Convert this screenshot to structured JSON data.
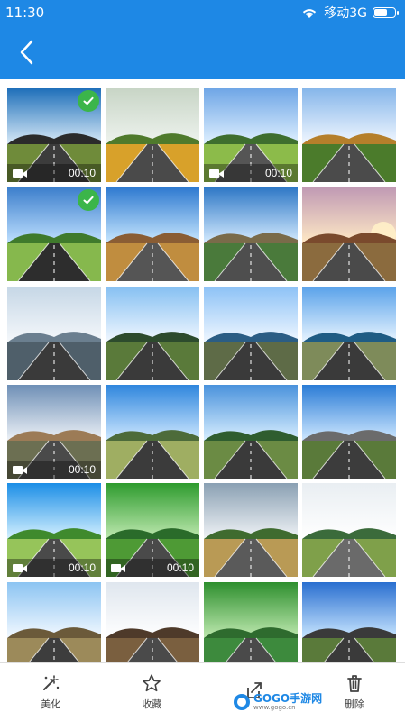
{
  "status": {
    "time": "11:30",
    "carrier": "移动3G"
  },
  "app": {
    "back_icon": "chevron-left-icon",
    "accent_color": "#1e88e5"
  },
  "grid": {
    "items": [
      {
        "duration": "00:10",
        "selected": true,
        "is_video": true
      },
      {
        "duration": "",
        "selected": false,
        "is_video": false
      },
      {
        "duration": "00:10",
        "selected": false,
        "is_video": true
      },
      {
        "duration": "",
        "selected": false,
        "is_video": false
      },
      {
        "duration": "",
        "selected": true,
        "is_video": false
      },
      {
        "duration": "",
        "selected": false,
        "is_video": false
      },
      {
        "duration": "",
        "selected": false,
        "is_video": false
      },
      {
        "duration": "",
        "selected": false,
        "is_video": false
      },
      {
        "duration": "",
        "selected": false,
        "is_video": false
      },
      {
        "duration": "",
        "selected": false,
        "is_video": false
      },
      {
        "duration": "",
        "selected": false,
        "is_video": false
      },
      {
        "duration": "",
        "selected": false,
        "is_video": false
      },
      {
        "duration": "00:10",
        "selected": false,
        "is_video": true
      },
      {
        "duration": "",
        "selected": false,
        "is_video": false
      },
      {
        "duration": "",
        "selected": false,
        "is_video": false
      },
      {
        "duration": "",
        "selected": false,
        "is_video": false
      },
      {
        "duration": "00:10",
        "selected": false,
        "is_video": true
      },
      {
        "duration": "00:10",
        "selected": false,
        "is_video": true
      },
      {
        "duration": "",
        "selected": false,
        "is_video": false
      },
      {
        "duration": "",
        "selected": false,
        "is_video": false
      },
      {
        "duration": "",
        "selected": false,
        "is_video": false
      },
      {
        "duration": "",
        "selected": false,
        "is_video": false
      },
      {
        "duration": "",
        "selected": false,
        "is_video": false
      },
      {
        "duration": "",
        "selected": false,
        "is_video": false
      }
    ]
  },
  "toolbar": {
    "beautify": {
      "label": "美化",
      "icon": "magic-wand-icon"
    },
    "favorite": {
      "label": "收藏",
      "icon": "star-icon"
    },
    "share": {
      "label": "",
      "icon": "share-icon"
    },
    "delete": {
      "label": "删除",
      "icon": "trash-icon"
    }
  },
  "watermark": {
    "text": "GOGO手游网",
    "sub": "www.gogo.cn"
  }
}
